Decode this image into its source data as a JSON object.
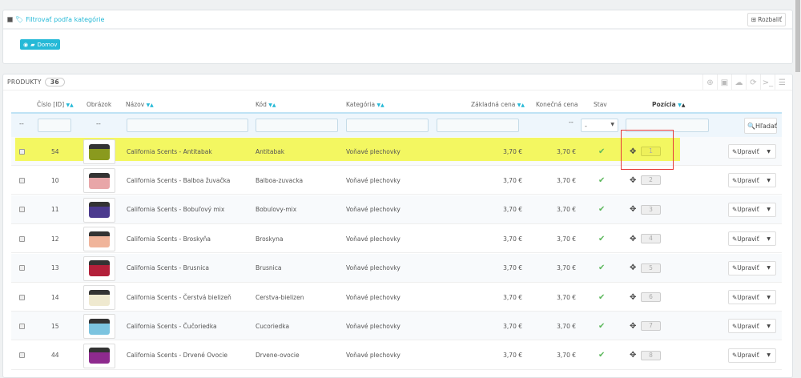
{
  "filter_panel": {
    "title": "Filtrovať podľa kategórie",
    "expand_label": "Rozbaliť",
    "category_button": "Domov"
  },
  "products_panel": {
    "title": "PRODUKTY",
    "count": "36",
    "toolbar_icons": [
      "add-icon",
      "export-icon",
      "cloud-upload-icon",
      "refresh-icon",
      "sql-query-icon",
      "database-icon"
    ]
  },
  "columns": {
    "id": "Číslo [ID]",
    "image": "Obrázok",
    "name": "Názov",
    "code": "Kód",
    "category": "Kategória",
    "base_price": "Základná cena",
    "final_price": "Konečná cena",
    "status": "Stav",
    "position": "Pozícia"
  },
  "filters": {
    "dash": "--",
    "status_select": "-",
    "search_label": "Hľadať"
  },
  "edit_label": "Upraviť",
  "highlight_color": "#f3f761",
  "rows": [
    {
      "id": "54",
      "name": "California Scents - Antitabak",
      "code": "Antitabak",
      "category": "Voňavé plechovky",
      "base": "3,70 €",
      "final": "3,70 €",
      "position": "1",
      "can_color": "#8a9a1e",
      "active": true
    },
    {
      "id": "10",
      "name": "California Scents - Balboa žuvačka",
      "code": "Balboa-zuvacka",
      "category": "Voňavé plechovky",
      "base": "3,70 €",
      "final": "3,70 €",
      "position": "2",
      "can_color": "#e8a6a8",
      "active": true
    },
    {
      "id": "11",
      "name": "California Scents - Bobuľový mix",
      "code": "Bobulovy-mix",
      "category": "Voňavé plechovky",
      "base": "3,70 €",
      "final": "3,70 €",
      "position": "3",
      "can_color": "#4b3a8e",
      "active": true
    },
    {
      "id": "12",
      "name": "California Scents - Broskyňa",
      "code": "Broskyna",
      "category": "Voňavé plechovky",
      "base": "3,70 €",
      "final": "3,70 €",
      "position": "4",
      "can_color": "#f0b49a",
      "active": true
    },
    {
      "id": "13",
      "name": "California Scents - Brusnica",
      "code": "Brusnica",
      "category": "Voňavé plechovky",
      "base": "3,70 €",
      "final": "3,70 €",
      "position": "5",
      "can_color": "#b3203a",
      "active": true
    },
    {
      "id": "14",
      "name": "California Scents - Čerstvá bielizeň",
      "code": "Cerstva-bielizen",
      "category": "Voňavé plechovky",
      "base": "3,70 €",
      "final": "3,70 €",
      "position": "6",
      "can_color": "#efe9cf",
      "active": true
    },
    {
      "id": "15",
      "name": "California Scents - Čučoriedka",
      "code": "Cucoriedka",
      "category": "Voňavé plechovky",
      "base": "3,70 €",
      "final": "3,70 €",
      "position": "7",
      "can_color": "#7cc4e0",
      "active": true
    },
    {
      "id": "44",
      "name": "California Scents - Drvené Ovocie",
      "code": "Drvene-ovocie",
      "category": "Voňavé plechovky",
      "base": "3,70 €",
      "final": "3,70 €",
      "position": "8",
      "can_color": "#8e2a8e",
      "active": true
    }
  ]
}
